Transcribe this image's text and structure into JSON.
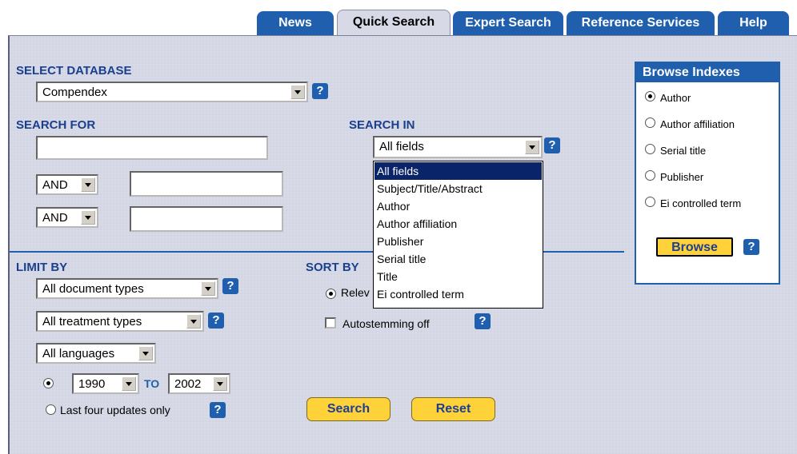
{
  "tabs": [
    {
      "label": "News"
    },
    {
      "label": "Quick Search"
    },
    {
      "label": "Expert Search"
    },
    {
      "label": "Reference Services"
    },
    {
      "label": "Help"
    }
  ],
  "select_database": {
    "heading": "SELECT DATABASE",
    "value": "Compendex"
  },
  "search_for": {
    "heading": "SEARCH FOR",
    "row2_operator": "AND",
    "row3_operator": "AND"
  },
  "search_in": {
    "heading": "SEARCH IN",
    "value": "All fields",
    "options": [
      "All fields",
      "Subject/Title/Abstract",
      "Author",
      "Author affiliation",
      "Publisher",
      "Serial title",
      "Title",
      "Ei controlled term"
    ]
  },
  "limit_by": {
    "heading": "LIMIT BY",
    "doc_types": "All document types",
    "treatment_types": "All treatment types",
    "languages": "All languages",
    "year_from": "1990",
    "to_label": "TO",
    "year_to": "2002",
    "last_updates_label": "Last four updates only"
  },
  "sort_by": {
    "heading": "SORT BY",
    "relevance_label": "Relev",
    "autostemming_label": "Autostemming off"
  },
  "buttons": {
    "search": "Search",
    "reset": "Reset",
    "browse": "Browse"
  },
  "browse_indexes": {
    "title": "Browse Indexes",
    "options": [
      "Author",
      "Author affiliation",
      "Serial title",
      "Publisher",
      "Ei controlled term"
    ]
  },
  "help_glyph": "?",
  "colors": {
    "tab_blue": "#1f5fae",
    "panel_bg": "#d7dae6",
    "button_yellow": "#ffd23a",
    "heading_blue": "#1a3f8f"
  }
}
